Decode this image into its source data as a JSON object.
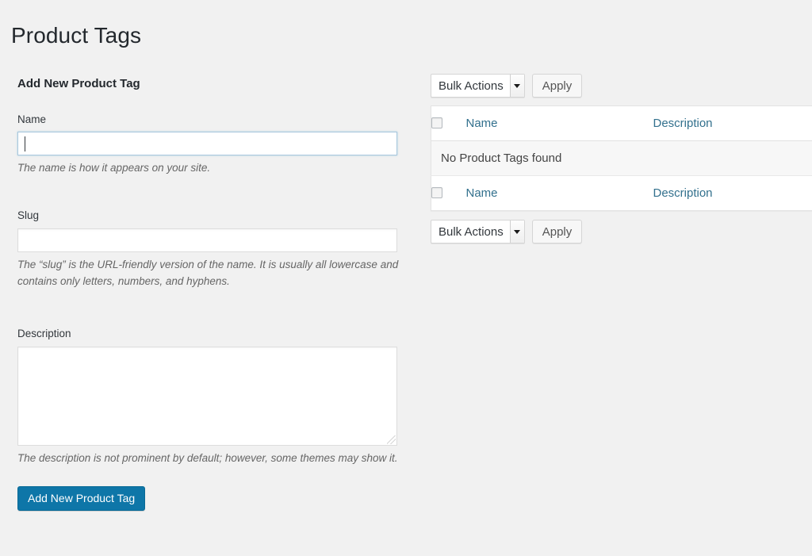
{
  "page": {
    "title": "Product Tags"
  },
  "form": {
    "heading": "Add New Product Tag",
    "name": {
      "label": "Name",
      "value": "",
      "placeholder": "",
      "help": "The name is how it appears on your site."
    },
    "slug": {
      "label": "Slug",
      "value": "",
      "placeholder": "",
      "help": "The “slug” is the URL-friendly version of the name. It is usually all lowercase and contains only letters, numbers, and hyphens."
    },
    "description": {
      "label": "Description",
      "value": "",
      "placeholder": "",
      "help": "The description is not prominent by default; however, some themes may show it."
    },
    "submit_label": "Add New Product Tag"
  },
  "list": {
    "bulk_actions_top": {
      "selected": "Bulk Actions",
      "apply_label": "Apply"
    },
    "bulk_actions_bottom": {
      "selected": "Bulk Actions",
      "apply_label": "Apply"
    },
    "columns": {
      "name": "Name",
      "description": "Description"
    },
    "empty_message": "No Product Tags found"
  },
  "colors": {
    "page_background": "#f1f1f1",
    "title_text": "#23282d",
    "link_blue": "#32708d",
    "primary_button": "#0e76a8",
    "input_border": "#dddddd",
    "input_focus_border": "#a9c7de",
    "help_text": "#666666"
  }
}
